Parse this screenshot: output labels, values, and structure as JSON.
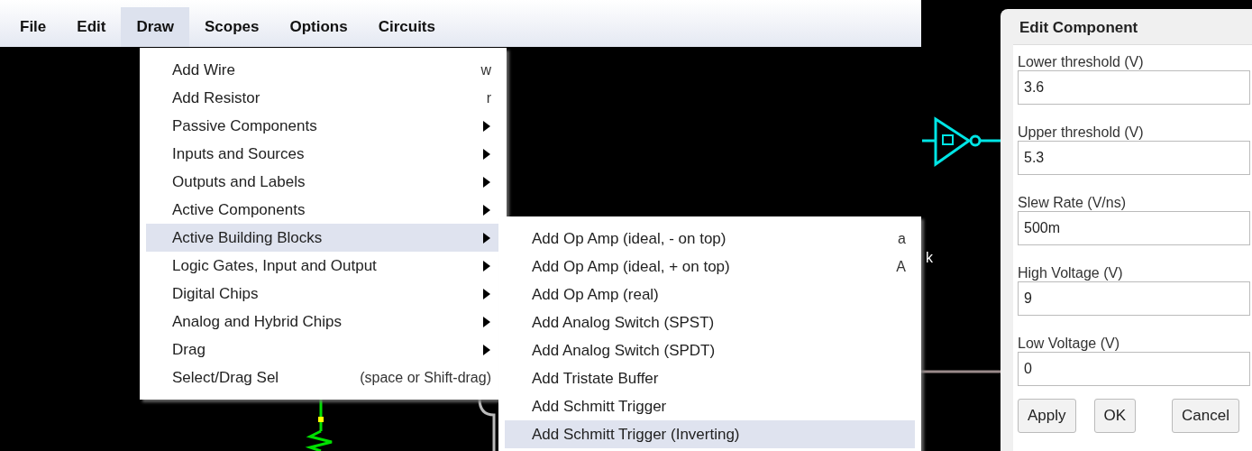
{
  "menubar": [
    {
      "label": "File",
      "selected": false
    },
    {
      "label": "Edit",
      "selected": false
    },
    {
      "label": "Draw",
      "selected": true
    },
    {
      "label": "Scopes",
      "selected": false
    },
    {
      "label": "Options",
      "selected": false
    },
    {
      "label": "Circuits",
      "selected": false
    }
  ],
  "draw_menu": [
    {
      "kind": "command",
      "label": "Add Wire",
      "shortcut": "w",
      "selected": false
    },
    {
      "kind": "command",
      "label": "Add Resistor",
      "shortcut": "r",
      "selected": false
    },
    {
      "kind": "submenu",
      "label": "Passive Components",
      "selected": false
    },
    {
      "kind": "submenu",
      "label": "Inputs and Sources",
      "selected": false
    },
    {
      "kind": "submenu",
      "label": "Outputs and Labels",
      "selected": false
    },
    {
      "kind": "submenu",
      "label": "Active Components",
      "selected": false
    },
    {
      "kind": "submenu",
      "label": "Active Building Blocks",
      "selected": true
    },
    {
      "kind": "submenu",
      "label": "Logic Gates, Input and Output",
      "selected": false
    },
    {
      "kind": "submenu",
      "label": "Digital Chips",
      "selected": false
    },
    {
      "kind": "submenu",
      "label": "Analog and Hybrid Chips",
      "selected": false
    },
    {
      "kind": "submenu",
      "label": "Drag",
      "selected": false
    },
    {
      "kind": "command",
      "label": "Select/Drag Sel",
      "shortcut": "(space or Shift-drag)",
      "selected": false
    }
  ],
  "submenu": [
    {
      "label": "Add Op Amp (ideal, - on top)",
      "shortcut": "a",
      "selected": false
    },
    {
      "label": "Add Op Amp (ideal, + on top)",
      "shortcut": "A",
      "selected": false
    },
    {
      "label": "Add Op Amp (real)",
      "selected": false
    },
    {
      "label": "Add Analog Switch (SPST)",
      "selected": false
    },
    {
      "label": "Add Analog Switch (SPDT)",
      "selected": false
    },
    {
      "label": "Add Tristate Buffer",
      "selected": false
    },
    {
      "label": "Add Schmitt Trigger",
      "selected": false
    },
    {
      "label": "Add Schmitt Trigger (Inverting)",
      "selected": true
    }
  ],
  "canvas": {
    "label": "k"
  },
  "dialog": {
    "title": "Edit Component",
    "fields": [
      {
        "label": "Lower threshold (V)",
        "value": "3.6"
      },
      {
        "label": "Upper threshold (V)",
        "value": "5.3"
      },
      {
        "label": "Slew Rate (V/ns)",
        "value": "500m"
      },
      {
        "label": "High Voltage (V)",
        "value": "9"
      },
      {
        "label": "Low Voltage (V)",
        "value": "0"
      }
    ],
    "buttons": [
      "Apply",
      "OK",
      "Cancel"
    ]
  }
}
